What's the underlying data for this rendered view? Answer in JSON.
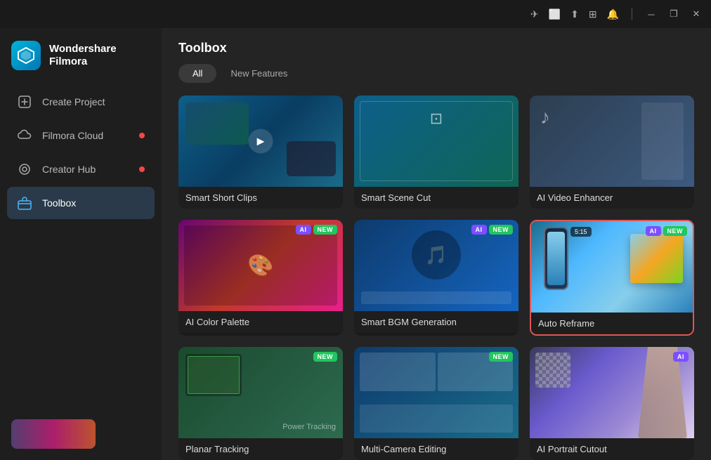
{
  "app": {
    "name": "Wondershare",
    "sub": "Filmora",
    "logo_char": "◆"
  },
  "titlebar": {
    "icons": [
      "send-icon",
      "monitor-icon",
      "upload-icon",
      "grid-icon",
      "bell-icon"
    ],
    "controls": [
      "minimize",
      "maximize",
      "close"
    ]
  },
  "sidebar": {
    "items": [
      {
        "id": "create-project",
        "label": "Create Project",
        "icon": "➕",
        "badge": false,
        "active": false
      },
      {
        "id": "filmora-cloud",
        "label": "Filmora Cloud",
        "icon": "☁",
        "badge": true,
        "active": false
      },
      {
        "id": "creator-hub",
        "label": "Creator Hub",
        "icon": "◎",
        "badge": true,
        "active": false
      },
      {
        "id": "toolbox",
        "label": "Toolbox",
        "icon": "🧰",
        "badge": false,
        "active": true
      }
    ]
  },
  "content": {
    "title": "Toolbox",
    "tabs": [
      {
        "id": "all",
        "label": "All",
        "active": true
      },
      {
        "id": "new-features",
        "label": "New Features",
        "active": false
      }
    ],
    "tools": [
      {
        "id": "smart-short-clips",
        "label": "Smart Short Clips",
        "badges": [],
        "thumb": "smart-short",
        "selected": false
      },
      {
        "id": "smart-scene-cut",
        "label": "Smart Scene Cut",
        "badges": [],
        "thumb": "smart-scene",
        "selected": false
      },
      {
        "id": "ai-video-enhancer",
        "label": "AI Video Enhancer",
        "badges": [],
        "thumb": "ai-video",
        "selected": false
      },
      {
        "id": "ai-color-palette",
        "label": "AI Color Palette",
        "badges": [
          "AI",
          "NEW"
        ],
        "thumb": "ai-color",
        "selected": false
      },
      {
        "id": "smart-bgm-generation",
        "label": "Smart BGM Generation",
        "badges": [
          "AI",
          "NEW"
        ],
        "thumb": "bgm",
        "selected": false
      },
      {
        "id": "auto-reframe",
        "label": "Auto Reframe",
        "badges": [
          "AI",
          "NEW"
        ],
        "thumb": "auto-reframe",
        "selected": true
      },
      {
        "id": "planar-tracking",
        "label": "Planar Tracking",
        "badges": [
          "NEW"
        ],
        "thumb": "planar",
        "selected": false
      },
      {
        "id": "multi-camera-editing",
        "label": "Multi-Camera Editing",
        "badges": [
          "NEW"
        ],
        "thumb": "multicam",
        "selected": false
      },
      {
        "id": "ai-portrait-cutout",
        "label": "AI Portrait Cutout",
        "badges": [
          "AI"
        ],
        "thumb": "portrait",
        "selected": false
      }
    ]
  }
}
